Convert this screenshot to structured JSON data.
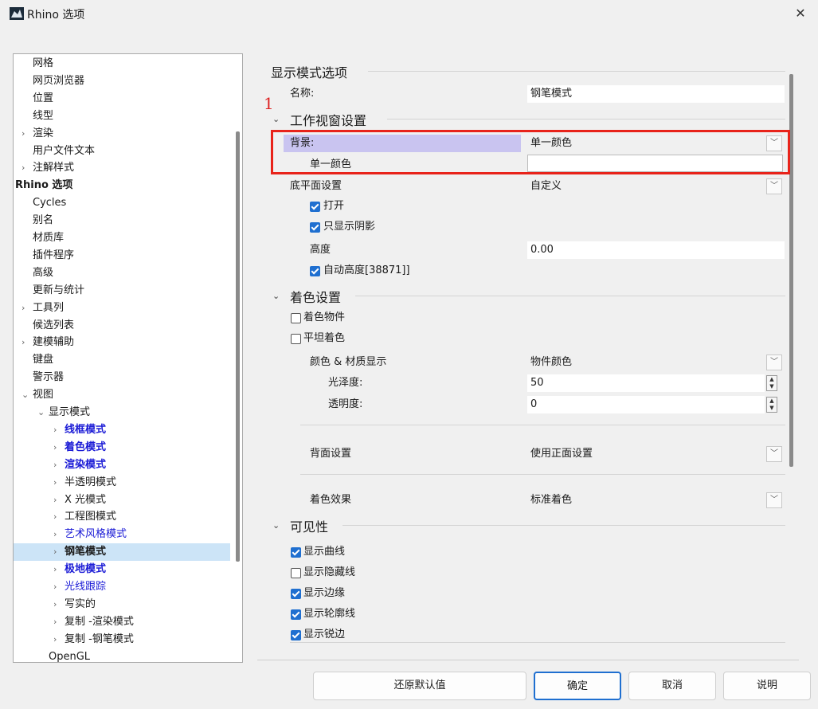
{
  "window": {
    "title": "Rhino 选项",
    "close": "✕"
  },
  "annotation": "1",
  "tree": [
    {
      "label": "网格",
      "indent": 0,
      "chev": ""
    },
    {
      "label": "网页浏览器",
      "indent": 0,
      "chev": ""
    },
    {
      "label": "位置",
      "indent": 0,
      "chev": ""
    },
    {
      "label": "线型",
      "indent": 0,
      "chev": ""
    },
    {
      "label": "渲染",
      "indent": 0,
      "chev": ">"
    },
    {
      "label": "用户文件文本",
      "indent": 0,
      "chev": ""
    },
    {
      "label": "注解样式",
      "indent": 0,
      "chev": ">"
    },
    {
      "label": "Rhino 选项",
      "indent": -1,
      "chev": "",
      "style": "bold"
    },
    {
      "label": "Cycles",
      "indent": 0,
      "chev": ""
    },
    {
      "label": "别名",
      "indent": 0,
      "chev": ""
    },
    {
      "label": "材质库",
      "indent": 0,
      "chev": ""
    },
    {
      "label": "插件程序",
      "indent": 0,
      "chev": ""
    },
    {
      "label": "高级",
      "indent": 0,
      "chev": ""
    },
    {
      "label": "更新与统计",
      "indent": 0,
      "chev": ""
    },
    {
      "label": "工具列",
      "indent": 0,
      "chev": ">"
    },
    {
      "label": "候选列表",
      "indent": 0,
      "chev": ""
    },
    {
      "label": "建模辅助",
      "indent": 0,
      "chev": ">"
    },
    {
      "label": "键盘",
      "indent": 0,
      "chev": ""
    },
    {
      "label": "警示器",
      "indent": 0,
      "chev": ""
    },
    {
      "label": "视图",
      "indent": 0,
      "chev": "v"
    },
    {
      "label": "显示模式",
      "indent": 1,
      "chev": "v"
    },
    {
      "label": "线框模式",
      "indent": 2,
      "chev": ">",
      "style": "blue"
    },
    {
      "label": "着色模式",
      "indent": 2,
      "chev": ">",
      "style": "blue"
    },
    {
      "label": "渲染模式",
      "indent": 2,
      "chev": ">",
      "style": "blue"
    },
    {
      "label": "半透明模式",
      "indent": 2,
      "chev": ">"
    },
    {
      "label": "X 光模式",
      "indent": 2,
      "chev": ">"
    },
    {
      "label": "工程图模式",
      "indent": 2,
      "chev": ">"
    },
    {
      "label": "艺术风格模式",
      "indent": 2,
      "chev": ">",
      "style": "blue-n"
    },
    {
      "label": "钢笔模式",
      "indent": 2,
      "chev": ">",
      "style": "bold",
      "selected": true
    },
    {
      "label": "极地模式",
      "indent": 2,
      "chev": ">",
      "style": "blue"
    },
    {
      "label": "光线跟踪",
      "indent": 2,
      "chev": ">",
      "style": "blue-n"
    },
    {
      "label": "写实的",
      "indent": 2,
      "chev": ">"
    },
    {
      "label": "复制 -渲染模式",
      "indent": 2,
      "chev": ">"
    },
    {
      "label": "复制 -钢笔模式",
      "indent": 2,
      "chev": ">"
    },
    {
      "label": "OpenGL",
      "indent": 1,
      "chev": ""
    }
  ],
  "panel": {
    "section_title": "显示模式选项",
    "name_label": "名称:",
    "name_value": "钢笔模式",
    "viewport": {
      "title": "工作视窗设置",
      "background_label": "背景:",
      "background_value": "单一颜色",
      "single_color_label": "单一颜色",
      "ground_plane_label": "底平面设置",
      "ground_plane_value": "自定义",
      "on_label": "打开",
      "on_checked": true,
      "shadow_only_label": "只显示阴影",
      "shadow_only_checked": true,
      "height_label": "高度",
      "height_value": "0.00",
      "auto_height_label": "自动高度[38871]]",
      "auto_height_checked": true
    },
    "shading": {
      "title": "着色设置",
      "shade_objects_label": "着色物件",
      "shade_objects_checked": false,
      "flat_shading_label": "平坦着色",
      "flat_shading_checked": false,
      "color_material_label": "颜色 & 材质显示",
      "color_material_value": "物件颜色",
      "gloss_label": "光泽度:",
      "gloss_value": "50",
      "transparency_label": "透明度:",
      "transparency_value": "0",
      "backface_label": "背面设置",
      "backface_value": "使用正面设置",
      "effect_label": "着色效果",
      "effect_value": "标准着色"
    },
    "visibility": {
      "title": "可见性",
      "items": [
        {
          "label": "显示曲线",
          "checked": true
        },
        {
          "label": "显示隐藏线",
          "checked": false
        },
        {
          "label": "显示边缘",
          "checked": true
        },
        {
          "label": "显示轮廓线",
          "checked": true
        },
        {
          "label": "显示锐边",
          "checked": true
        }
      ]
    }
  },
  "buttons": {
    "restore": "还原默认值",
    "ok": "确定",
    "cancel": "取消",
    "help": "说明"
  },
  "colors": {
    "accent": "#1f6fd0",
    "highlight": "#e8231a",
    "selection": "#cce4f7"
  }
}
